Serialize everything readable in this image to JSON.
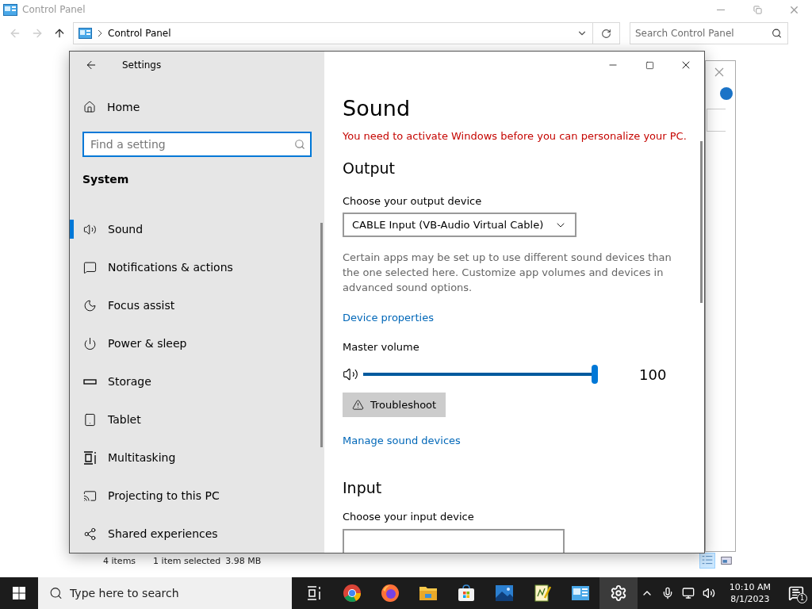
{
  "control_panel": {
    "title": "Control Panel",
    "breadcrumb": "Control Panel",
    "search": {
      "placeholder": "Search Control Panel"
    },
    "status_bar": {
      "item_count": "4 items",
      "selection": "1 item selected",
      "size": "3.98 MB"
    }
  },
  "settings": {
    "title": "Settings",
    "home": "Home",
    "search": {
      "placeholder": "Find a setting"
    },
    "section": "System",
    "nav": [
      {
        "label": "Sound",
        "kind": "sound",
        "selected": true
      },
      {
        "label": "Notifications & actions",
        "kind": "notifications",
        "selected": false
      },
      {
        "label": "Focus assist",
        "kind": "focus",
        "selected": false
      },
      {
        "label": "Power & sleep",
        "kind": "power",
        "selected": false
      },
      {
        "label": "Storage",
        "kind": "storage",
        "selected": false
      },
      {
        "label": "Tablet",
        "kind": "tablet",
        "selected": false
      },
      {
        "label": "Multitasking",
        "kind": "multitasking",
        "selected": false
      },
      {
        "label": "Projecting to this PC",
        "kind": "projecting",
        "selected": false
      },
      {
        "label": "Shared experiences",
        "kind": "shared",
        "selected": false
      }
    ],
    "page": {
      "title": "Sound",
      "warning": "You need to activate Windows before you can personalize your PC.",
      "output": {
        "heading": "Output",
        "device_label": "Choose your output device",
        "device": "CABLE Input (VB-Audio Virtual Cable)",
        "description": "Certain apps may be set up to use different sound devices than the one selected here. Customize app volumes and devices in advanced sound options.",
        "properties_link": "Device properties",
        "volume_label": "Master volume",
        "volume": {
          "level": 1.0,
          "reading": "100"
        },
        "troubleshoot": "Troubleshoot",
        "manage_link": "Manage sound devices"
      },
      "input": {
        "heading": "Input",
        "device_label": "Choose your input device"
      }
    }
  },
  "taskbar": {
    "search_placeholder": "Type here to search",
    "apps": [
      {
        "kind": "taskview",
        "selected": false
      },
      {
        "kind": "chrome",
        "selected": false
      },
      {
        "kind": "firefox",
        "selected": false
      },
      {
        "kind": "explorer",
        "selected": false
      },
      {
        "kind": "store",
        "selected": false
      },
      {
        "kind": "photos",
        "selected": false
      },
      {
        "kind": "editor",
        "selected": false
      },
      {
        "kind": "controlpanel",
        "selected": false
      },
      {
        "kind": "settings",
        "selected": true
      }
    ],
    "time": "10:10 AM",
    "date": "8/1/2023",
    "notification_count": "1"
  }
}
